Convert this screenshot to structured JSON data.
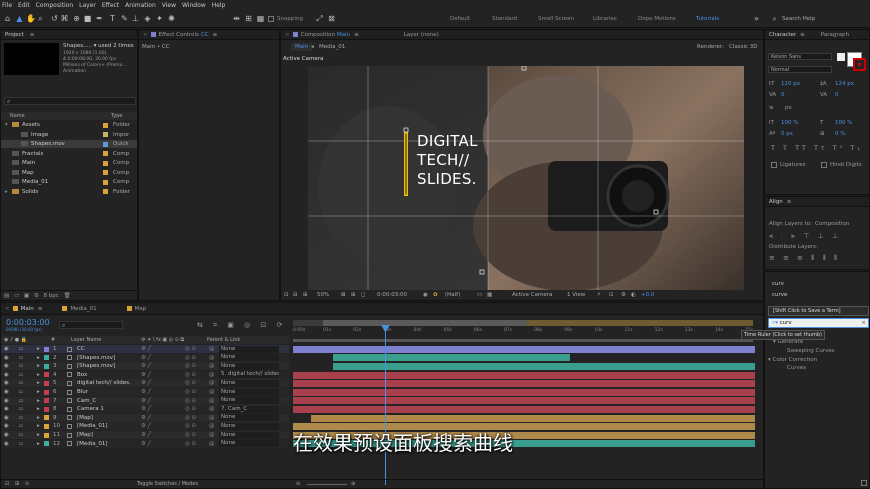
{
  "menu": [
    "File",
    "Edit",
    "Composition",
    "Layer",
    "Effect",
    "Animation",
    "View",
    "Window",
    "Help"
  ],
  "toolbar": {
    "snapping": "Snapping",
    "workspaces": [
      "Default",
      "Standard",
      "Small Screen",
      "Libraries",
      "Dope Motions",
      "Tutorials"
    ],
    "active_workspace": "Tutorials",
    "search_help": "Search Help"
  },
  "project": {
    "tab": "Project",
    "selected_name": "Shapes.....",
    "used": "used 2 times",
    "info": [
      "1920 x 1080 (1.00)",
      "Δ 0:00:08:00, 30.00 fps",
      "Millions of Colors+ (Premu...",
      "Animation"
    ],
    "col_name": "Name",
    "col_type": "Type",
    "items": [
      {
        "name": "Assets",
        "type": "Folder",
        "color": "#d9a33a",
        "indent": 0,
        "folder": true
      },
      {
        "name": "Image",
        "type": "Impor",
        "color": "#c9b06b",
        "indent": 1,
        "folder": false
      },
      {
        "name": "Shapes.mov",
        "type": "Quick",
        "color": "#5b9bd5",
        "indent": 1,
        "folder": false,
        "selected": true
      },
      {
        "name": "Fractals",
        "type": "Comp",
        "color": "#d9a33a",
        "indent": 0,
        "folder": false
      },
      {
        "name": "Main",
        "type": "Comp",
        "color": "#d9a33a",
        "indent": 0,
        "folder": false
      },
      {
        "name": "Map",
        "type": "Comp",
        "color": "#d9a33a",
        "indent": 0,
        "folder": false
      },
      {
        "name": "Media_01",
        "type": "Comp",
        "color": "#d9a33a",
        "indent": 0,
        "folder": false
      },
      {
        "name": "Solids",
        "type": "Folder",
        "color": "#d9a33a",
        "indent": 0,
        "folder": true
      }
    ],
    "bpc": "8 bpc"
  },
  "effect_controls": {
    "tab": "Effect Controls",
    "layer": "CC",
    "breadcrumb": "Main • CC"
  },
  "composition": {
    "tab": "Composition",
    "tab_name": "Main",
    "layer_tab": "Layer (none)",
    "crumbs": [
      "Main",
      "Media_01"
    ],
    "renderer_label": "Renderer:",
    "renderer": "Classic 3D",
    "camera_label": "Active Camera",
    "headline": [
      "DIGITAL",
      "TECH//",
      "SLIDES."
    ],
    "footer": {
      "zoom": "50%",
      "time": "0:00:03:00",
      "quality": "(Half)",
      "view": "Active Camera",
      "views": "1 View",
      "exposure": "+0.0"
    }
  },
  "character": {
    "tab": "Character",
    "tab2": "Paragraph",
    "font": "Kelson Sans",
    "style": "Normal",
    "size": "120 px",
    "leading": "124 px",
    "kerning": "0",
    "tracking": "0",
    "stroke": "px",
    "vscale": "100 %",
    "hscale": "100 %",
    "baseline": "0 px",
    "tsume": "0 %",
    "ligatures": "Ligatures",
    "hindi": "Hindi Digits"
  },
  "align": {
    "tab": "Align",
    "align_to_label": "Align Layers to:",
    "align_to": "Composition",
    "distribute": "Distribute Layers:"
  },
  "effects_panel": {
    "history": [
      "curv",
      "curve"
    ],
    "tooltip": "[Shift Click to Save a Term]",
    "search": "curv",
    "thumb_tip": "Time Ruler (Click to set thumb)",
    "groups": [
      {
        "name": "Generate",
        "items": [
          "Sweeping Curves"
        ]
      },
      {
        "name": "Color Correction",
        "items": [
          "Curves"
        ]
      }
    ]
  },
  "timeline": {
    "tabs": [
      "Main",
      "Media_01",
      "Map"
    ],
    "timecode": "0:00:03:00",
    "timecode_sub": "00090 (30.00 fps)",
    "col_layer": "Layer Name",
    "col_parent": "Parent & Link",
    "ruler": [
      "0:00s",
      "01s",
      "02s",
      "03s",
      "04s",
      "05s",
      "06s",
      "07s",
      "08s",
      "09s",
      "10s",
      "11s",
      "12s",
      "13s",
      "14s",
      "15s"
    ],
    "layers": [
      {
        "n": "1",
        "name": "CC",
        "label": "#7f7fcf",
        "parent": "None",
        "bar": "#7f7fcf",
        "start": 0,
        "end": 15
      },
      {
        "n": "2",
        "name": "[Shapes.mov]",
        "label": "#3bb0a0",
        "parent": "None",
        "bar": "#3a9e8e",
        "start": 1.3,
        "end": 9
      },
      {
        "n": "3",
        "name": "[Shapes.mov]",
        "label": "#3bb0a0",
        "parent": "None",
        "bar": "#3a9e8e",
        "start": 1.3,
        "end": 15
      },
      {
        "n": "4",
        "name": "Box",
        "label": "#c04050",
        "parent": "5. digital tech// slides",
        "bar": "#a8404e",
        "start": 0,
        "end": 15
      },
      {
        "n": "5",
        "name": "digital tech// slides.",
        "label": "#c04050",
        "parent": "None",
        "bar": "#a8404e",
        "start": 0,
        "end": 15
      },
      {
        "n": "6",
        "name": "Blur",
        "label": "#c04050",
        "parent": "None",
        "bar": "#a8404e",
        "start": 0,
        "end": 15
      },
      {
        "n": "7",
        "name": "Cam_C",
        "label": "#c04050",
        "parent": "None",
        "bar": "#a8404e",
        "start": 0,
        "end": 15
      },
      {
        "n": "8",
        "name": "Camera 1",
        "label": "#c04050",
        "parent": "7. Cam_C",
        "bar": "#a8404e",
        "start": 0,
        "end": 15
      },
      {
        "n": "9",
        "name": "[Map]",
        "label": "#d9a33a",
        "parent": "None",
        "bar": "#b08a4a",
        "start": 0.6,
        "end": 15
      },
      {
        "n": "10",
        "name": "[Media_01]",
        "label": "#d9a33a",
        "parent": "None",
        "bar": "#b08a4a",
        "start": 0,
        "end": 15
      },
      {
        "n": "11",
        "name": "[Map]",
        "label": "#d9a33a",
        "parent": "None",
        "bar": "#b08a4a",
        "start": 0,
        "end": 15
      },
      {
        "n": "12",
        "name": "[Media_01]",
        "label": "#3bb0a0",
        "parent": "None",
        "bar": "#3a9e8e",
        "start": 0,
        "end": 15
      }
    ],
    "toggle": "Toggle Switches / Modes",
    "subtitle": "在效果预设面板搜索曲线"
  }
}
